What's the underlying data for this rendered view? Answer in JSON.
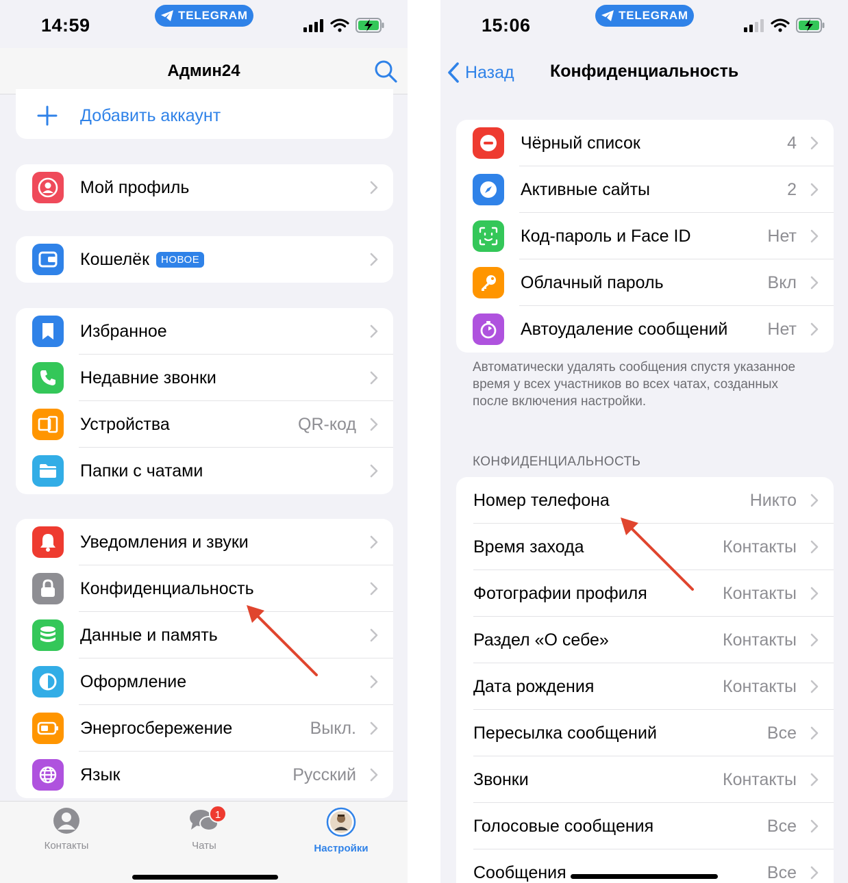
{
  "left": {
    "status": {
      "time": "14:59",
      "pill": "TELEGRAM"
    },
    "header": {
      "title": "Админ24"
    },
    "add_account": "Добавить аккаунт",
    "profile": {
      "label": "Мой профиль"
    },
    "wallet": {
      "label": "Кошелёк",
      "badge": "НОВОЕ"
    },
    "group1": [
      {
        "label": "Избранное",
        "value": ""
      },
      {
        "label": "Недавние звонки",
        "value": ""
      },
      {
        "label": "Устройства",
        "value": "QR-код"
      },
      {
        "label": "Папки с чатами",
        "value": ""
      }
    ],
    "group2": [
      {
        "label": "Уведомления и звуки",
        "value": ""
      },
      {
        "label": "Конфиденциальность",
        "value": ""
      },
      {
        "label": "Данные и память",
        "value": ""
      },
      {
        "label": "Оформление",
        "value": ""
      },
      {
        "label": "Энергосбережение",
        "value": "Выкл."
      },
      {
        "label": "Язык",
        "value": "Русский"
      }
    ],
    "tabbar": {
      "contacts": "Контакты",
      "chats": "Чаты",
      "chats_badge": "1",
      "settings": "Настройки"
    }
  },
  "right": {
    "status": {
      "time": "15:06",
      "pill": "TELEGRAM"
    },
    "header": {
      "back": "Назад",
      "title": "Конфиденциальность"
    },
    "security": [
      {
        "label": "Чёрный список",
        "value": "4"
      },
      {
        "label": "Активные сайты",
        "value": "2"
      },
      {
        "label": "Код-пароль и Face ID",
        "value": "Нет"
      },
      {
        "label": "Облачный пароль",
        "value": "Вкл"
      },
      {
        "label": "Автоудаление сообщений",
        "value": "Нет"
      }
    ],
    "footnote": "Автоматически удалять сообщения спустя указанное время у всех участников во всех чатах, созданных после включения настройки.",
    "section_title": "КОНФИДЕНЦИАЛЬНОСТЬ",
    "privacy": [
      {
        "label": "Номер телефона",
        "value": "Никто"
      },
      {
        "label": "Время захода",
        "value": "Контакты"
      },
      {
        "label": "Фотографии профиля",
        "value": "Контакты"
      },
      {
        "label": "Раздел «О себе»",
        "value": "Контакты"
      },
      {
        "label": "Дата рождения",
        "value": "Контакты"
      },
      {
        "label": "Пересылка сообщений",
        "value": "Все"
      },
      {
        "label": "Звонки",
        "value": "Контакты"
      },
      {
        "label": "Голосовые сообщения",
        "value": "Все"
      },
      {
        "label": "Сообщения",
        "value": "Все"
      }
    ]
  },
  "colors": {
    "accent": "#2f82e8",
    "annotation_arrow": "#e0452e",
    "badge_red": "#ee3b30"
  }
}
